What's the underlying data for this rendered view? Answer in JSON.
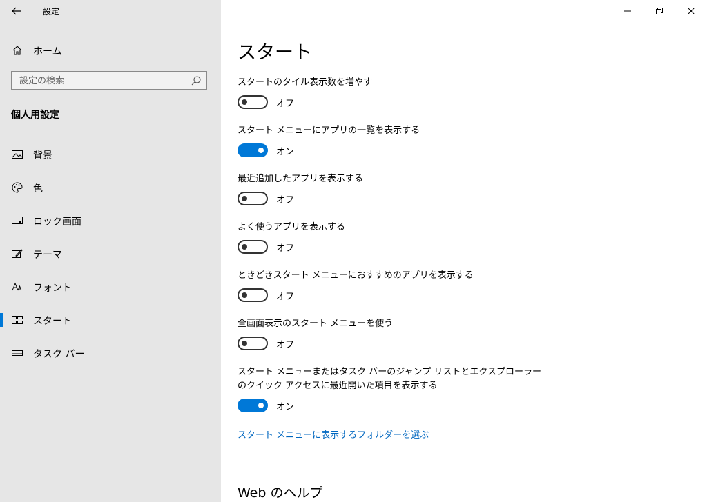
{
  "window": {
    "title": "設定",
    "controls": [
      "minimize-icon",
      "restore-icon",
      "close-icon"
    ]
  },
  "sidebar": {
    "home_label": "ホーム",
    "search": {
      "placeholder": "設定の検索",
      "value": ""
    },
    "section_title": "個人用設定",
    "items": [
      {
        "label": "背景",
        "icon": "picture-icon"
      },
      {
        "label": "色",
        "icon": "palette-icon"
      },
      {
        "label": "ロック画面",
        "icon": "lock-screen-icon"
      },
      {
        "label": "テーマ",
        "icon": "theme-icon"
      },
      {
        "label": "フォント",
        "icon": "font-icon"
      },
      {
        "label": "スタート",
        "icon": "start-icon",
        "active": true
      },
      {
        "label": "タスク バー",
        "icon": "taskbar-icon"
      }
    ]
  },
  "main": {
    "title": "スタート",
    "settings": [
      {
        "label": "スタートのタイル表示数を増やす",
        "state": "オフ",
        "on": false
      },
      {
        "label": "スタート メニューにアプリの一覧を表示する",
        "state": "オン",
        "on": true
      },
      {
        "label": "最近追加したアプリを表示する",
        "state": "オフ",
        "on": false
      },
      {
        "label": "よく使うアプリを表示する",
        "state": "オフ",
        "on": false
      },
      {
        "label": "ときどきスタート メニューにおすすめのアプリを表示する",
        "state": "オフ",
        "on": false
      },
      {
        "label": "全画面表示のスタート メニューを使う",
        "state": "オフ",
        "on": false
      },
      {
        "label": "スタート メニューまたはタスク バーのジャンプ リストとエクスプローラーのクイック アクセスに最近開いた項目を表示する",
        "state": "オン",
        "on": true
      }
    ],
    "folder_link": "スタート メニューに表示するフォルダーを選ぶ",
    "help_title": "Web のヘルプ"
  },
  "colors": {
    "accent": "#0078d7",
    "sidebar_bg": "#e6e6e6",
    "link": "#0067c0"
  }
}
